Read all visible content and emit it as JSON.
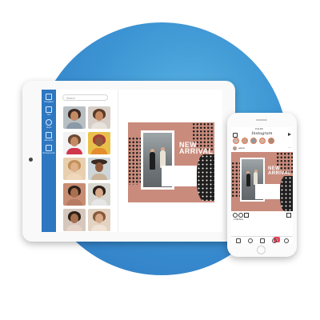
{
  "tablet": {
    "sidebar": {
      "items": [
        {
          "label": "Templates",
          "icon": "templates-icon"
        },
        {
          "label": "Text",
          "icon": "text-icon"
        },
        {
          "label": "Stock",
          "icon": "stock-icon"
        },
        {
          "label": "Elements",
          "icon": "elements-icon"
        },
        {
          "label": "Backgrounds",
          "icon": "backgrounds-icon"
        }
      ]
    },
    "search": {
      "placeholder": "Search"
    },
    "design": {
      "headline": [
        "NEW",
        "ARRIVAL"
      ]
    }
  },
  "phone": {
    "app_title": "Instagram",
    "status_time": "9:41 AM",
    "post": {
      "username": "pazzar",
      "likes": "♥ 999 likes",
      "menu": "···"
    },
    "notification_count": "1",
    "design": {
      "headline": [
        "NEW",
        "ARRIVAL"
      ]
    }
  },
  "colors": {
    "brand_blue": "#2e77c1",
    "background_circle": "#3c93d2",
    "design_terracotta": "#c98b7c",
    "notification_red": "#e9475b"
  }
}
